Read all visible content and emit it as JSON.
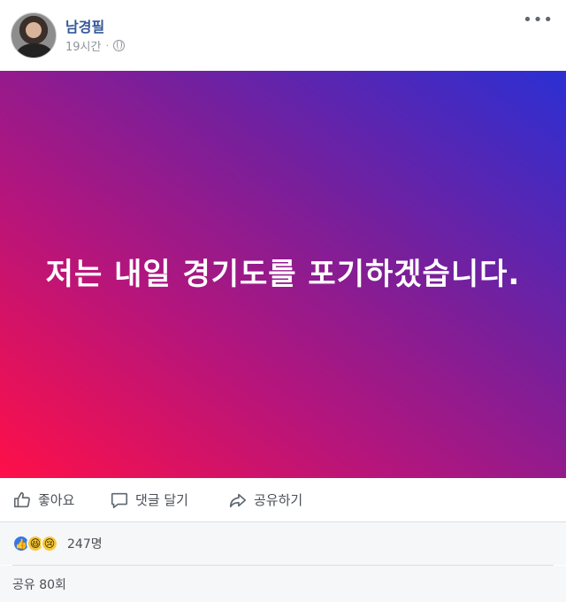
{
  "post": {
    "author": "남경필",
    "time": "19시간",
    "separator": "·",
    "privacy_icon": "globe-icon",
    "menu_icon": "more-horizontal-icon",
    "text": "저는 내일 경기도를 포기하겠습니다.",
    "background_colors": [
      "#ff0f48",
      "#b5157c",
      "#7a1f9a",
      "#2b2fd3"
    ]
  },
  "actions": {
    "like_label": "좋아요",
    "comment_label": "댓글 달기",
    "share_label": "공유하기"
  },
  "reactions": {
    "types": [
      "like",
      "haha",
      "sad"
    ],
    "count": "247명"
  },
  "shares": {
    "label": "공유 80회"
  }
}
